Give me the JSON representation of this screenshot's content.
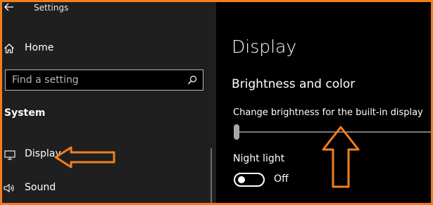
{
  "window": {
    "title": "Settings"
  },
  "sidebar": {
    "home_label": "Home",
    "search": {
      "placeholder": "Find a setting"
    },
    "section_title": "System",
    "items": [
      {
        "label": "Display",
        "icon": "monitor-icon",
        "selected": true
      },
      {
        "label": "Sound",
        "icon": "speaker-icon",
        "selected": false
      }
    ]
  },
  "main": {
    "title": "Display",
    "subtitle": "Brightness and color",
    "brightness": {
      "label": "Change brightness for the built-in display",
      "value": 0
    },
    "night_light": {
      "label": "Night light",
      "state": "Off"
    }
  },
  "colors": {
    "annotation": "#f07f1e",
    "sidebar_bg": "#1f1f1f",
    "main_bg": "#000000",
    "text": "#ffffff"
  }
}
